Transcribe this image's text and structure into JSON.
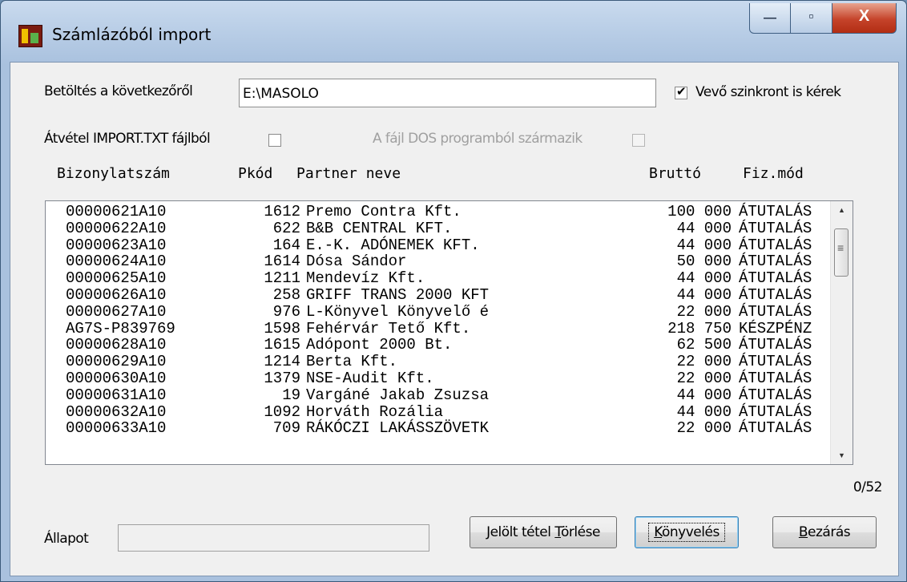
{
  "window": {
    "title": "Számlázóból import",
    "controls": {
      "minimize": "—",
      "maximize": "▫",
      "close": "X"
    }
  },
  "form": {
    "path_label": "Betöltés a következőről",
    "path_value": "E:\\MASOLO",
    "sync_label": "Vevő szinkront is kérek",
    "sync_checked": true,
    "import_label": "Átvétel IMPORT.TXT fájlból",
    "import_checked": false,
    "dos_label": "A fájl DOS programból származik",
    "dos_checked": false
  },
  "table": {
    "headers": [
      "Bizonylatszám",
      "Pkód",
      "Partner neve",
      "Bruttó",
      "Fiz.mód"
    ],
    "rows": [
      [
        "00000621A10",
        "1612",
        "Premo Contra Kft.",
        "100 000",
        "ÁTUTALÁS"
      ],
      [
        "00000622A10",
        "622",
        "B&B CENTRAL KFT.",
        "44 000",
        "ÁTUTALÁS"
      ],
      [
        "00000623A10",
        "164",
        "E.-K. ADÓNEMEK KFT.",
        "44 000",
        "ÁTUTALÁS"
      ],
      [
        "00000624A10",
        "1614",
        "Dósa Sándor",
        "50 000",
        "ÁTUTALÁS"
      ],
      [
        "00000625A10",
        "1211",
        "Mendevíz Kft.",
        "44 000",
        "ÁTUTALÁS"
      ],
      [
        "00000626A10",
        "258",
        "GRIFF TRANS 2000 KFT",
        "44 000",
        "ÁTUTALÁS"
      ],
      [
        "00000627A10",
        "976",
        "L-Könyvel Könyvelő é",
        "22 000",
        "ÁTUTALÁS"
      ],
      [
        "AG7S-P839769",
        "1598",
        "Fehérvár Tető Kft.",
        "218 750",
        "KÉSZPÉNZ"
      ],
      [
        "00000628A10",
        "1615",
        "Adópont 2000 Bt.",
        "62 500",
        "ÁTUTALÁS"
      ],
      [
        "00000629A10",
        "1214",
        "Berta Kft.",
        "22 000",
        "ÁTUTALÁS"
      ],
      [
        "00000630A10",
        "1379",
        "NSE-Audit Kft.",
        "22 000",
        "ÁTUTALÁS"
      ],
      [
        "00000631A10",
        "19",
        "Vargáné Jakab Zsuzsa",
        "44 000",
        "ÁTUTALÁS"
      ],
      [
        "00000632A10",
        "1092",
        "Horváth Rozália",
        "44 000",
        "ÁTUTALÁS"
      ],
      [
        "00000633A10",
        "709",
        "RÁKÓCZI LAKÁSSZÖVETK",
        "22 000",
        "ÁTUTALÁS"
      ]
    ]
  },
  "counter": "0/52",
  "status": {
    "label": "Állapot",
    "value": ""
  },
  "buttons": {
    "delete_pre": "Jelölt tétel ",
    "delete_key": "T",
    "delete_post": "örlése",
    "post_key": "K",
    "post_rest": "önyvelés",
    "close_key": "B",
    "close_rest": "ezárás"
  },
  "colors": {
    "title_bar": "#b8cde6",
    "close_button": "#c5432a",
    "client_bg": "#f0f0f0"
  }
}
